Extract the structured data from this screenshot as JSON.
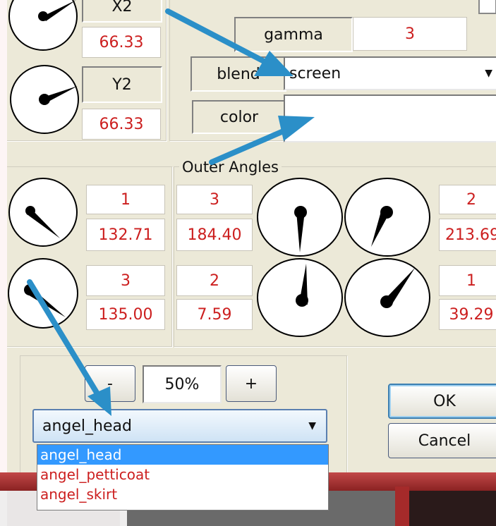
{
  "top_left": {
    "x2_label": "X2",
    "x2_value": "66.33",
    "y2_label": "Y2",
    "y2_value": "66.33"
  },
  "top_right": {
    "gamma_label": "gamma",
    "gamma_value": "3",
    "blend_label": "blend",
    "blend_value": "screen",
    "color_label": "color",
    "color_value": ""
  },
  "outer_angles": {
    "title": "Outer Angles",
    "left": [
      {
        "index": "1",
        "value": "132.71"
      },
      {
        "index": "3",
        "value": "135.00"
      }
    ],
    "right": [
      {
        "index_a": "3",
        "value_a": "184.40",
        "index_b": "2",
        "value_b": "213.69"
      },
      {
        "index_a": "2",
        "value_a": "7.59",
        "index_b": "1",
        "value_b": "39.29"
      }
    ]
  },
  "zoom": {
    "minus_label": "-",
    "value": "50%",
    "plus_label": "+"
  },
  "buttons": {
    "ok_label": "OK",
    "cancel_label": "Cancel"
  },
  "part_select": {
    "selected": "angel_head",
    "options": [
      "angel_head",
      "angel_petticoat",
      "angel_skirt"
    ]
  },
  "colors": {
    "value_text": "#cc1f1f",
    "arrow": "#2b8fc8",
    "selection": "#3399ff"
  }
}
